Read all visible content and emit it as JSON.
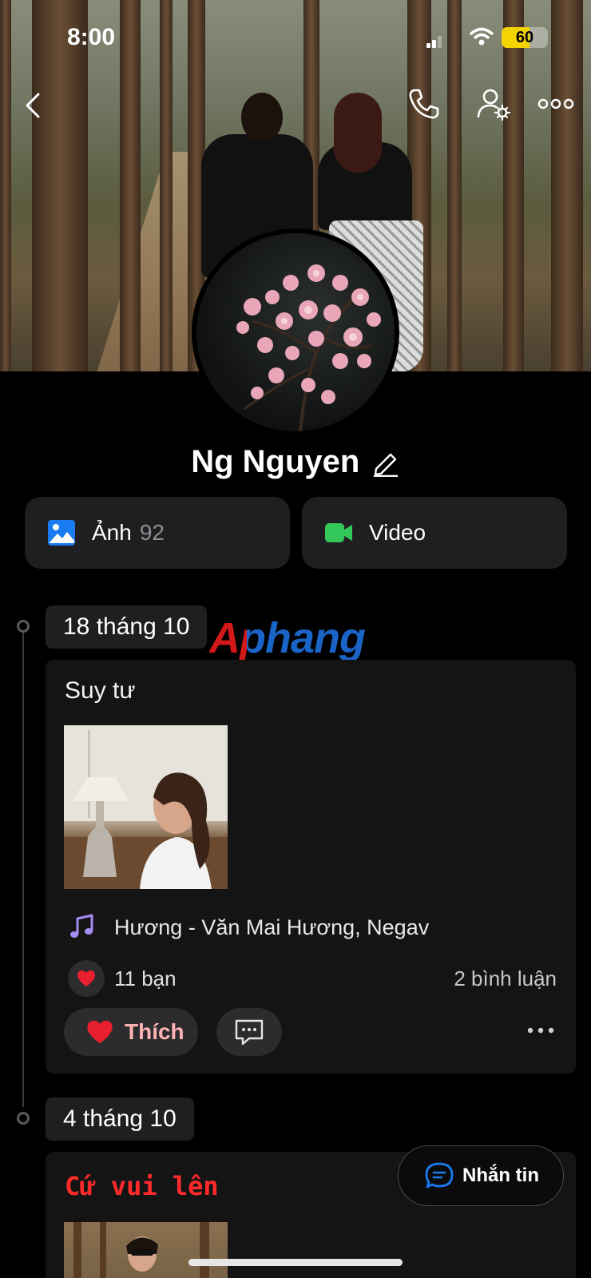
{
  "status_bar": {
    "time": "8:00",
    "battery": "60",
    "battery_level": 0.6
  },
  "profile": {
    "name": "Ng Nguyen"
  },
  "media": {
    "photos_label": "Ảnh",
    "photos_count": "92",
    "video_label": "Video"
  },
  "watermark": "Aphang",
  "timeline": [
    {
      "date": "18 tháng 10",
      "post": {
        "title": "Suy tư",
        "music": "Hương - Văn Mai Hương, Negav",
        "reactions": "11 bạn",
        "comments": "2 bình luận",
        "like_label": "Thích"
      }
    },
    {
      "date": "4 tháng 10",
      "post": {
        "title": "Cứ vui lên"
      }
    }
  ],
  "chat_button": {
    "label": "Nhắn tin"
  },
  "colors": {
    "accent_blue": "#1a7cf0",
    "video_green": "#34c759",
    "heart_red": "#e8202e",
    "title_red": "#ff2a2a",
    "music_purple": "#a58cf2"
  }
}
